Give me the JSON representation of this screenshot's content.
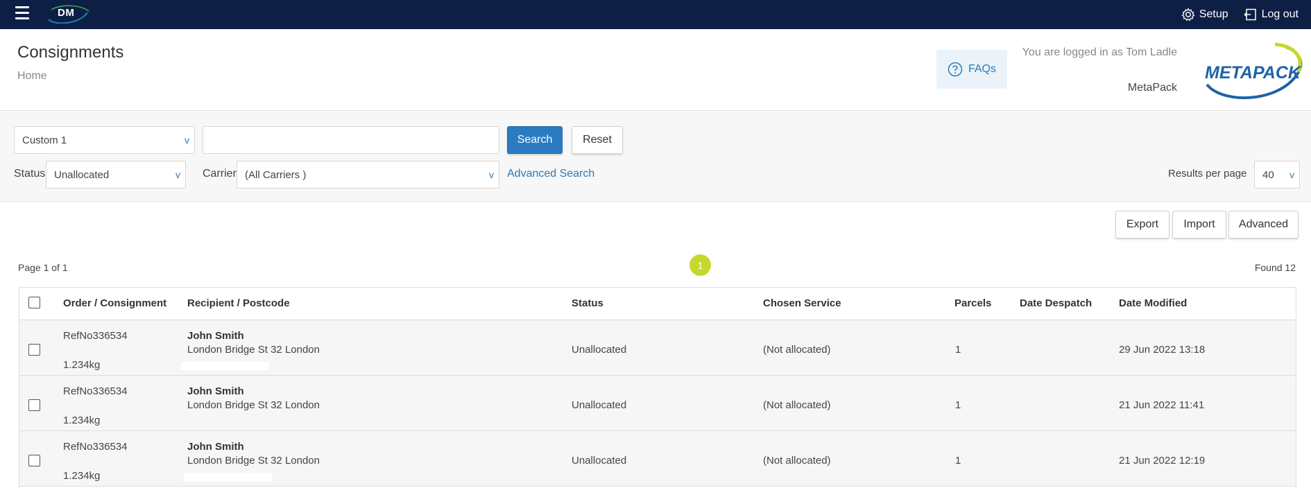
{
  "nav": {
    "logo_text": "DM",
    "setup_label": "Setup",
    "logout_label": "Log out"
  },
  "header": {
    "title": "Consignments",
    "breadcrumb": "Home",
    "faq_label": "FAQs",
    "logged_in": "You are logged in as Tom Ladle",
    "company": "MetaPack",
    "logo_text": "METAPACK"
  },
  "filters": {
    "field_select": "Custom 1",
    "search_value": "",
    "search_label": "Search",
    "reset_label": "Reset",
    "status_label": "Status",
    "status_value": "Unallocated",
    "carrier_label": "Carrier",
    "carrier_value": "(All Carriers )",
    "advanced_search_label": "Advanced Search",
    "results_per_page_label": "Results per page",
    "results_per_page_value": "40",
    "caret": "v"
  },
  "actions": {
    "export_label": "Export",
    "import_label": "Import",
    "advanced_label": "Advanced"
  },
  "results": {
    "page_info": "Page 1 of 1",
    "current_page": "1",
    "found": "Found 12"
  },
  "table": {
    "headers": {
      "order": "Order / Consignment",
      "recipient": "Recipient / Postcode",
      "status": "Status",
      "service": "Chosen Service",
      "parcels": "Parcels",
      "despatch": "Date Despatch",
      "modified": "Date Modified"
    },
    "rows": [
      {
        "ref": "RefNo336534",
        "weight": "1.234kg",
        "name": "John Smith",
        "address": "London Bridge St 32 London",
        "status": "Unallocated",
        "service": "(Not allocated)",
        "parcels": "1",
        "despatch": "",
        "modified": "29 Jun 2022 13:18"
      },
      {
        "ref": "RefNo336534",
        "weight": "1.234kg",
        "name": "John Smith",
        "address": "London Bridge St 32 London",
        "status": "Unallocated",
        "service": "(Not allocated)",
        "parcels": "1",
        "despatch": "",
        "modified": "21 Jun 2022 11:41"
      },
      {
        "ref": "RefNo336534",
        "weight": "1.234kg",
        "name": "John Smith",
        "address": "London Bridge St 32 London",
        "status": "Unallocated",
        "service": "(Not allocated)",
        "parcels": "1",
        "despatch": "",
        "modified": "21 Jun 2022 12:19"
      }
    ]
  }
}
